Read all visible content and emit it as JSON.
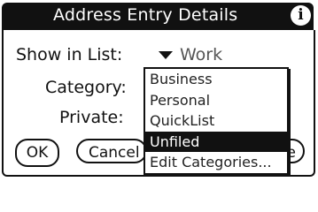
{
  "window": {
    "title": "Address Entry Details",
    "info_icon": "info-icon",
    "info_glyph": "i"
  },
  "form": {
    "show_in_list_label": "Show in List:",
    "show_in_list_value": "Work",
    "category_label": "Category:",
    "private_label": "Private:"
  },
  "buttons": {
    "ok_label": "OK",
    "cancel_label": "Cancel",
    "details_label": "e"
  },
  "popup": {
    "items": [
      {
        "label": "Business",
        "selected": false
      },
      {
        "label": "Personal",
        "selected": false
      },
      {
        "label": "QuickList",
        "selected": false
      },
      {
        "label": "Unfiled",
        "selected": true
      },
      {
        "label": "Edit Categories...",
        "selected": false
      }
    ]
  }
}
